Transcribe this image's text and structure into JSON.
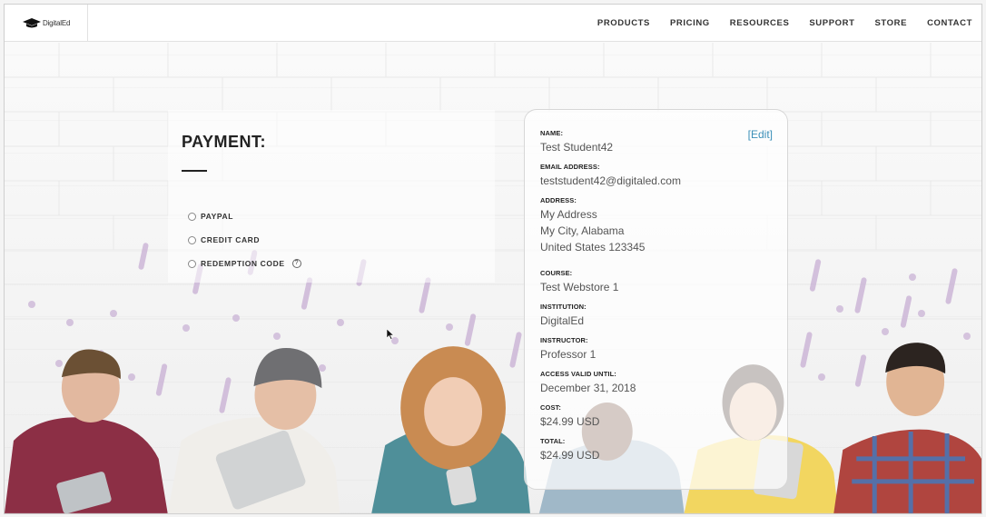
{
  "header": {
    "logo_text": "DigitalEd",
    "nav": [
      "PRODUCTS",
      "PRICING",
      "RESOURCES",
      "SUPPORT",
      "STORE",
      "CONTACT"
    ]
  },
  "payment": {
    "title": "PAYMENT:",
    "options": [
      "PAYPAL",
      "CREDIT CARD",
      "REDEMPTION CODE"
    ],
    "help_glyph": "?"
  },
  "summary": {
    "edit_label": "[Edit]",
    "name_label": "NAME:",
    "name": "Test Student42",
    "email_label": "EMAIL ADDRESS:",
    "email": "teststudent42@digitaled.com",
    "address_label": "ADDRESS:",
    "address_line1": "My Address",
    "address_line2": "My City, Alabama",
    "address_line3": "United States 123345",
    "course_label": "COURSE:",
    "course": "Test Webstore 1",
    "institution_label": "INSTITUTION:",
    "institution": "DigitalEd",
    "instructor_label": "INSTRUCTOR:",
    "instructor": "Professor 1",
    "access_label": "ACCESS VALID UNTIL:",
    "access": "December 31, 2018",
    "cost_label": "COST:",
    "cost": "$24.99 USD",
    "total_label": "TOTAL:",
    "total": "$24.99 USD"
  },
  "colors": {
    "accent_link": "#3b8fb8",
    "dot_purple": "#b79ac6",
    "text_dark": "#222222"
  }
}
